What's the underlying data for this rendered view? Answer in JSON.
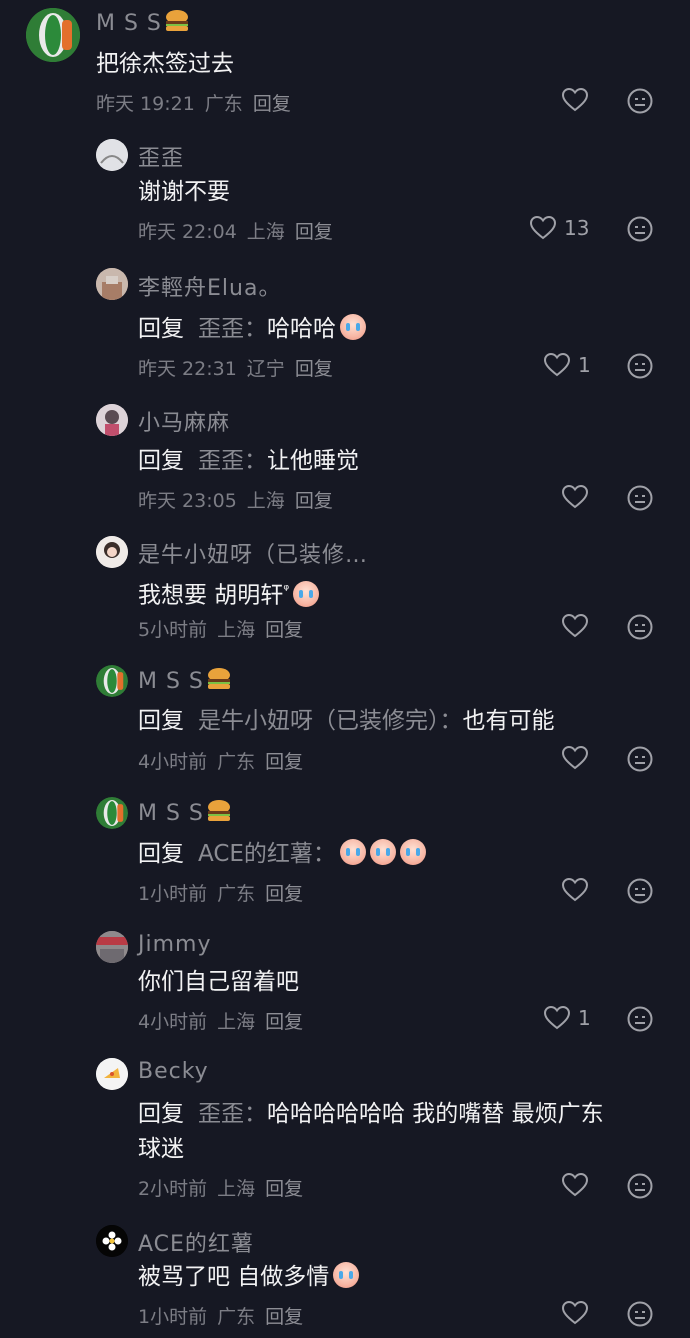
{
  "comments": [
    {
      "name": "M S S",
      "text": "把徐杰签过去",
      "time": "昨天 19:21",
      "loc": "广东",
      "reply": "回复",
      "likes": ""
    },
    {
      "name": "歪歪",
      "text": "谢谢不要",
      "time": "昨天 22:04",
      "loc": "上海",
      "reply": "回复",
      "likes": "13"
    },
    {
      "name": "李輕舟Elua。",
      "prefix": "回复",
      "target": "歪歪：",
      "text": "哈哈哈",
      "time": "昨天 22:31",
      "loc": "辽宁",
      "reply": "回复",
      "likes": "1"
    },
    {
      "name": "小马麻麻",
      "prefix": "回复",
      "target": "歪歪：",
      "text": "让他睡觉",
      "time": "昨天 23:05",
      "loc": "上海",
      "reply": "回复",
      "likes": ""
    },
    {
      "name": "是牛小妞呀（已装修…",
      "text": "我想要 胡明轩",
      "mention_mark": "ᵠ",
      "time": "5小时前",
      "loc": "上海",
      "reply": "回复",
      "likes": ""
    },
    {
      "name": "M S S",
      "prefix": "回复",
      "target": "是牛小妞呀（已装修完）：",
      "text": "也有可能",
      "time": "4小时前",
      "loc": "广东",
      "reply": "回复",
      "likes": ""
    },
    {
      "name": "M S S",
      "prefix": "回复",
      "target": "ACE的红薯：",
      "text": "",
      "time": "1小时前",
      "loc": "广东",
      "reply": "回复",
      "likes": ""
    },
    {
      "name": "Jimmy",
      "text": "你们自己留着吧",
      "time": "4小时前",
      "loc": "上海",
      "reply": "回复",
      "likes": "1"
    },
    {
      "name": "Becky",
      "prefix": "回复",
      "target": "歪歪：",
      "text": "哈哈哈哈哈哈 我的嘴替 最烦广东",
      "text2": "球迷",
      "time": "2小时前",
      "loc": "上海",
      "reply": "回复",
      "likes": ""
    },
    {
      "name": "ACE的红薯",
      "text": "被骂了吧 自做多情",
      "time": "1小时前",
      "loc": "广东",
      "reply": "回复",
      "likes": ""
    }
  ],
  "icons": {
    "like": "heart-outline-icon",
    "emoji": "neutral-face-icon",
    "cry": "crying-face-emoji",
    "burger": "burger-emoji"
  },
  "colors": {
    "background": "#161823",
    "text": "#f2f2f3",
    "muted": "#8b8c93"
  }
}
